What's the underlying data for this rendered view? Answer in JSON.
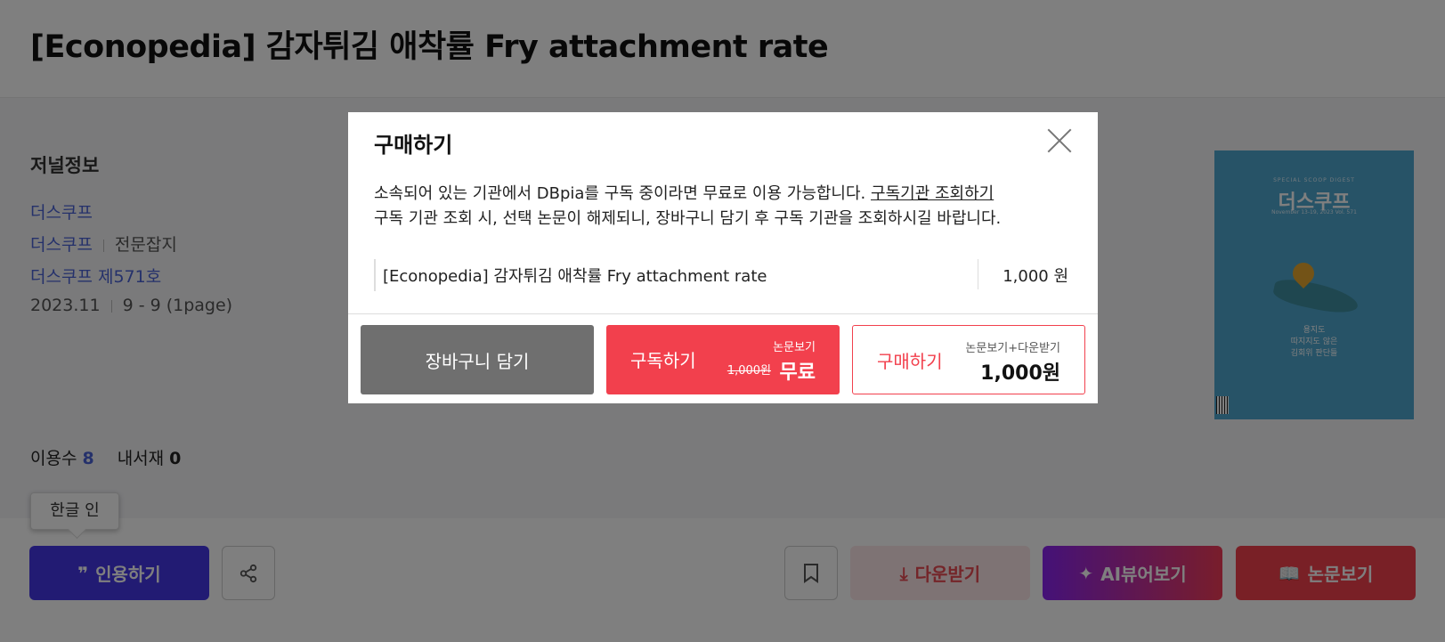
{
  "page": {
    "title": "[Econopedia] 감자튀김 애착률 Fry attachment rate"
  },
  "journal": {
    "section_title": "저널정보",
    "publisher": "더스쿠프",
    "journal_name": "더스쿠프",
    "journal_type": "전문잡지",
    "issue": "더스쿠프 제571호",
    "date": "2023.11",
    "pages": "9 - 9 (1page)"
  },
  "cover": {
    "top_text": "SPECIAL SCOOP DIGEST",
    "title": "더스쿠프",
    "subtitle": "November 13-19, 2023 Vol. 571",
    "caption_line1": "용지도",
    "caption_line2": "따지지도 않은",
    "caption_line3": "김회위 판단들"
  },
  "stats": {
    "usage_label": "이용수",
    "usage_value": "8",
    "library_label": "내서재",
    "library_value": "0"
  },
  "tooltip": {
    "text": "한글 인"
  },
  "actions": {
    "cite_label": "인용하기",
    "download_label": "다운받기",
    "ai_label": "AI뷰어보기",
    "view_label": "논문보기"
  },
  "modal": {
    "title": "구매하기",
    "desc_line1": "소속되어 있는 기관에서 DBpia를 구독 중이라면 무료로 이용 가능합니다.",
    "desc_link": "구독기관 조회하기",
    "desc_line2": "구독 기관 조회 시, 선택 논문이 해제되니, 장바구니 담기 후 구독 기관을 조회하시길 바랍니다.",
    "item_name": "[Econopedia] 감자튀김 애착률 Fry attachment rate",
    "item_price": "1,000 원",
    "cart_label": "장바구니 담기",
    "subscribe_label": "구독하기",
    "subscribe_small": "논문보기",
    "subscribe_original": "1,000원",
    "subscribe_price": "무료",
    "buy_label": "구매하기",
    "buy_small": "논문보기+다운받기",
    "buy_price": "1,000원"
  }
}
